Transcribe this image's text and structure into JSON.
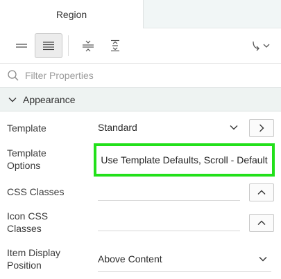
{
  "tabs": {
    "active": "Region"
  },
  "toolbar": {
    "icons": [
      "compact-view-icon",
      "comfortable-view-icon",
      "collapse-all-icon",
      "expand-all-icon",
      "go-to-group-icon"
    ]
  },
  "filter": {
    "placeholder": "Filter Properties"
  },
  "section": {
    "title": "Appearance"
  },
  "properties": {
    "template": {
      "label": "Template",
      "value": "Standard"
    },
    "template_options": {
      "label": "Template Options",
      "value": "Use Template Defaults, Scroll - Default"
    },
    "css_classes": {
      "label": "CSS Classes",
      "value": ""
    },
    "icon_css_classes": {
      "label": "Icon CSS Classes",
      "value": ""
    },
    "item_display_position": {
      "label": "Item Display Position",
      "value": "Above Content"
    }
  },
  "colors": {
    "highlight_border": "#22e01a",
    "section_bg": "#eef3f2",
    "tab_bar_bg": "#f1f6f6"
  }
}
